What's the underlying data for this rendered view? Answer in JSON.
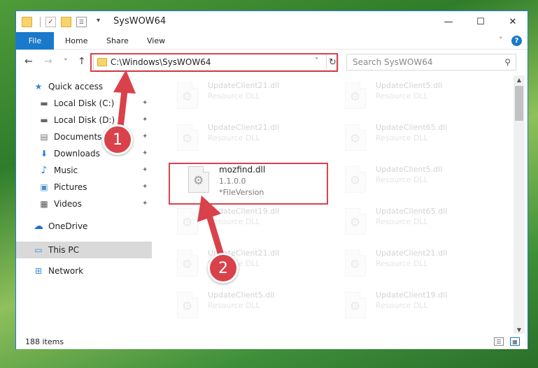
{
  "window": {
    "title": "SysWOW64"
  },
  "titlebar": {
    "minimize_glyph": "—",
    "maximize_glyph": "☐",
    "close_glyph": "✕",
    "quick_access_dropdown": "▾"
  },
  "ribbon": {
    "tabs": [
      "File",
      "Home",
      "Share",
      "View"
    ],
    "expand_glyph": "˅",
    "help_glyph": "?"
  },
  "nav": {
    "back_glyph": "←",
    "forward_glyph": "→",
    "recent_glyph": "˅",
    "up_glyph": "↑",
    "address": "C:\\Windows\\SysWOW64",
    "address_dropdown": "˅",
    "refresh_glyph": "↻",
    "search_placeholder": "Search SysWOW64",
    "search_glyph": "⚲"
  },
  "sidebar": {
    "items": [
      {
        "label": "Quick access",
        "icon": "star-icon",
        "glyph": "★",
        "pinned": false
      },
      {
        "label": "Local Disk (C:)",
        "icon": "drive-icon",
        "glyph": "▬",
        "pinned": true
      },
      {
        "label": "Local Disk (D:)",
        "icon": "drive-icon",
        "glyph": "▬",
        "pinned": true
      },
      {
        "label": "Documents",
        "icon": "documents-icon",
        "glyph": "▤",
        "pinned": true
      },
      {
        "label": "Downloads",
        "icon": "download-icon",
        "glyph": "⬇",
        "pinned": true
      },
      {
        "label": "Music",
        "icon": "music-icon",
        "glyph": "♪",
        "pinned": true
      },
      {
        "label": "Pictures",
        "icon": "pictures-icon",
        "glyph": "▣",
        "pinned": true
      },
      {
        "label": "Videos",
        "icon": "videos-icon",
        "glyph": "▦",
        "pinned": true
      },
      {
        "label": "OneDrive",
        "icon": "cloud-icon",
        "glyph": "☁",
        "pinned": false
      },
      {
        "label": "This PC",
        "icon": "computer-icon",
        "glyph": "▭",
        "pinned": false
      },
      {
        "label": "Network",
        "icon": "network-icon",
        "glyph": "⊞",
        "pinned": false
      }
    ],
    "pin_glyph": "📌"
  },
  "files": [
    {
      "name": "UpdateClient21.dll",
      "line2": "Resource DLL",
      "line3": "",
      "highlighted": false
    },
    {
      "name": "UpdateClient5.dll",
      "line2": "Resource DLL",
      "line3": "",
      "highlighted": false
    },
    {
      "name": "UpdateClient21.dll",
      "line2": "Resource DLL",
      "line3": "",
      "highlighted": false
    },
    {
      "name": "UpdateClient65.dll",
      "line2": "Resource DLL",
      "line3": "",
      "highlighted": false
    },
    {
      "name": "mozfind.dll",
      "line2": "1.1.0.0",
      "line3": "*FileVersion",
      "highlighted": true
    },
    {
      "name": "UpdateClient5.dll",
      "line2": "Resource DLL",
      "line3": "",
      "highlighted": false
    },
    {
      "name": "UpdateClient19.dll",
      "line2": "Resource DLL",
      "line3": "",
      "highlighted": false
    },
    {
      "name": "UpdateClient65.dll",
      "line2": "Resource DLL",
      "line3": "",
      "highlighted": false
    },
    {
      "name": "UpdateClient21.dll",
      "line2": "Resource DLL",
      "line3": "",
      "highlighted": false
    },
    {
      "name": "UpdateClient21.dll",
      "line2": "Resource DLL",
      "line3": "",
      "highlighted": false
    },
    {
      "name": "UpdateClient5.dll",
      "line2": "Resource DLL",
      "line3": "",
      "highlighted": false
    },
    {
      "name": "UpdateClient19.dll",
      "line2": "Resource DLL",
      "line3": "",
      "highlighted": false
    }
  ],
  "file_icon_glyph": "⚙",
  "statusbar": {
    "item_count": "188 items"
  },
  "annotations": {
    "step1": "1",
    "step2": "2",
    "color": "#d9424a"
  },
  "colors": {
    "accent": "#1979ca",
    "highlight_box": "#d9424a"
  }
}
